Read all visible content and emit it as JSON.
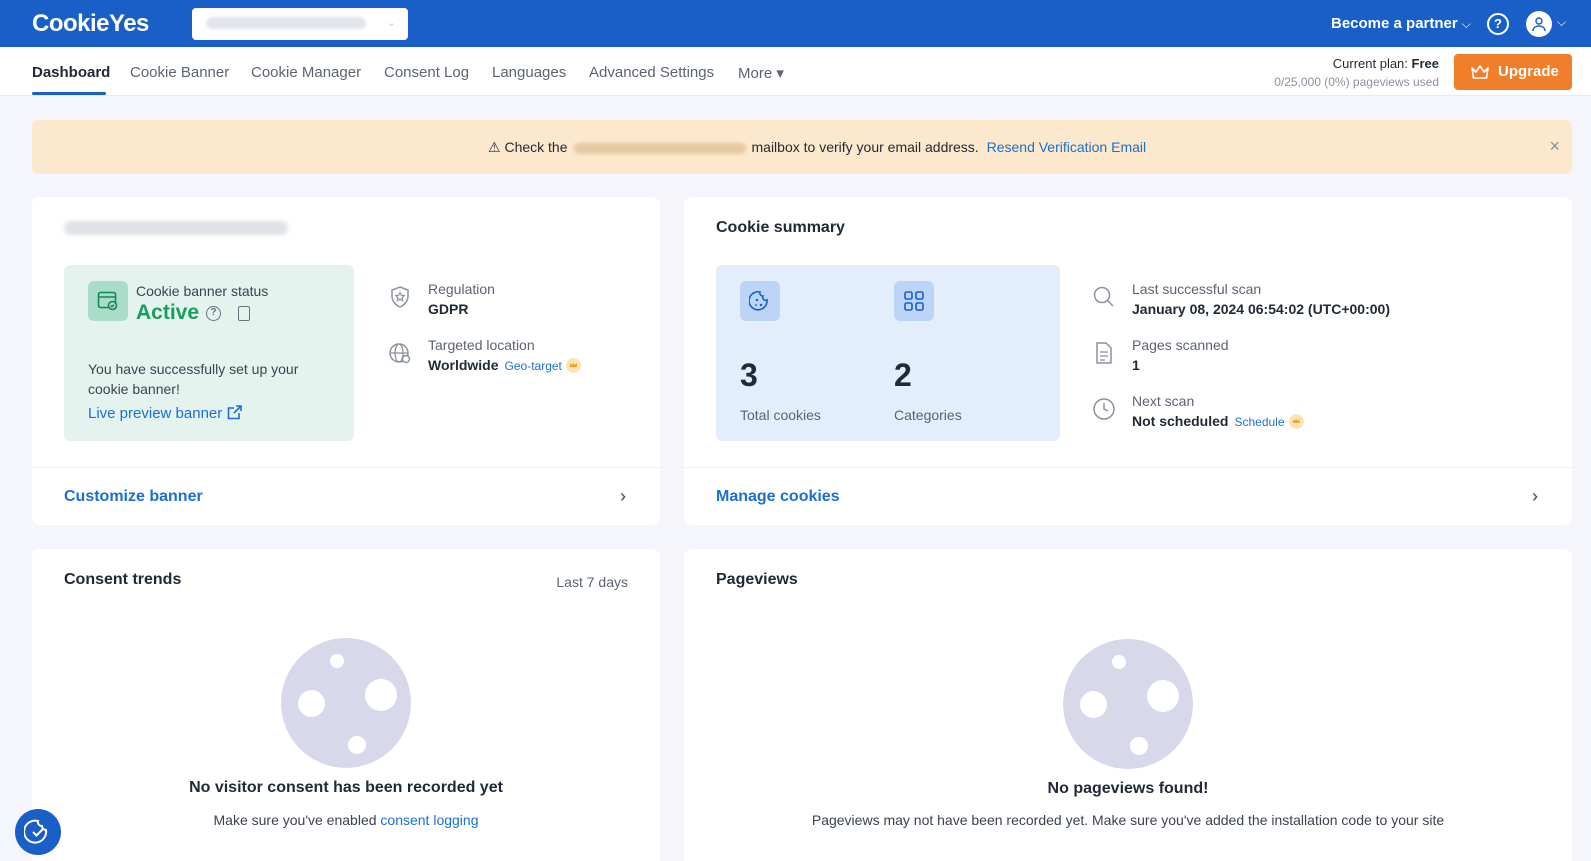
{
  "header": {
    "logo": "CookieYes",
    "become_partner": "Become a partner",
    "help_icon": "?"
  },
  "nav": {
    "tabs": [
      {
        "label": "Dashboard"
      },
      {
        "label": "Cookie Banner"
      },
      {
        "label": "Cookie Manager"
      },
      {
        "label": "Consent Log"
      },
      {
        "label": "Languages"
      },
      {
        "label": "Advanced Settings"
      },
      {
        "label": "More ▾"
      }
    ],
    "active_tab": "Dashboard",
    "plan_label": "Current plan:",
    "plan_name": "Free",
    "pageviews_used": "0/25,000 (0%) pageviews used",
    "upgrade_label": "Upgrade"
  },
  "alert": {
    "prefix": "Check the",
    "suffix": "mailbox to verify your email address.",
    "link": "Resend Verification Email",
    "close": "×"
  },
  "site_card": {
    "status_label": "Cookie banner status",
    "status_value": "Active",
    "success_message": "You have successfully set up your cookie banner!",
    "preview_link": "Live preview banner",
    "regulation_label": "Regulation",
    "regulation_value": "GDPR",
    "location_label": "Targeted location",
    "location_value": "Worldwide",
    "geo_target": "Geo-target",
    "footer_link": "Customize banner"
  },
  "cookie_summary": {
    "title": "Cookie summary",
    "total_cookies": "3",
    "total_cookies_label": "Total cookies",
    "categories": "2",
    "categories_label": "Categories",
    "last_scan_label": "Last successful scan",
    "last_scan_value": "January 08, 2024 06:54:02  (UTC+00:00)",
    "pages_scanned_label": "Pages scanned",
    "pages_scanned_value": "1",
    "next_scan_label": "Next scan",
    "next_scan_value": "Not scheduled",
    "schedule_link": "Schedule",
    "footer_link": "Manage cookies"
  },
  "consent_trends": {
    "title": "Consent trends",
    "period": "Last 7 days",
    "empty_title": "No visitor consent has been recorded yet",
    "empty_sub_prefix": "Make sure you've enabled",
    "empty_sub_link": "consent logging"
  },
  "pageviews": {
    "title": "Pageviews",
    "empty_title": "No pageviews found!",
    "empty_sub": "Pageviews may not have been recorded yet. Make sure you've added the installation code to your site"
  },
  "colors": {
    "brand": "#1a5fc7",
    "upgrade": "#f07e2b",
    "success": "#16a05d",
    "link": "#1a6fd1",
    "alert_bg": "#fce8cc"
  }
}
